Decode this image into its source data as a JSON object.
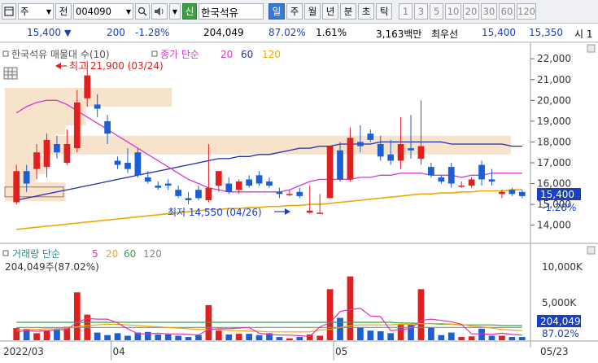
{
  "toolbar": {
    "window_icon": "window-icon",
    "type_select": "주",
    "prev_button": "전",
    "code": "004090",
    "stock_name": "한국석유",
    "credit_badge": "신",
    "periods": [
      "일",
      "주",
      "월",
      "년",
      "분",
      "초",
      "틱"
    ],
    "minutes": [
      "1",
      "3",
      "5",
      "10",
      "20",
      "30",
      "60",
      "120"
    ],
    "selected_period": "일"
  },
  "quote": {
    "price": "15,400",
    "change_arrow": "▼",
    "change": "200",
    "change_rate": "-1.28%",
    "volume": "204,049",
    "volume_ratio": "87.02%",
    "turnover_rate": "1.61%",
    "amount": "3,163백만",
    "pref_label": "최우선",
    "ask": "15,400",
    "bid": "15,350",
    "extra": "시 1"
  },
  "colors": {
    "up": "#e01f1f",
    "down": "#1a5fd6",
    "ma5": "#e52fb6",
    "ma20": "#d63bd0",
    "ma60": "#1c2fb0",
    "ma120": "#f0a800",
    "profile": "#f7e2cc"
  },
  "price_panel": {
    "title": "한국석유 매물대 수(10)",
    "ma_label": "종가 단순",
    "ma_periods": [
      "20",
      "60",
      "120"
    ],
    "high_note": "최고 21,900 (03/24)",
    "low_note": "최저 14,550 (04/26)",
    "axis_labels": [
      "22,000",
      "21,000",
      "20,000",
      "19,000",
      "18,000",
      "17,000",
      "16,000",
      "15,000",
      "14,000"
    ],
    "current_price": "15,400",
    "current_rate": "-1.28%"
  },
  "volume_panel": {
    "title": "거래량 단순",
    "ma_periods": [
      "5",
      "20",
      "60",
      "120"
    ],
    "value_label": "204,049주(87.02%)",
    "axis_labels": [
      "10,000K",
      "5,000K"
    ],
    "current_volume": "204,049",
    "current_ratio": "87.02%"
  },
  "x_axis": {
    "labels": [
      "2022/03",
      "04",
      "05",
      "05/23"
    ]
  },
  "chart_data": {
    "type": "candlestick",
    "title": "한국석유 매물대 수(10)",
    "ylim": [
      13400,
      22400
    ],
    "volume_ylim": [
      0,
      12500
    ],
    "candles": [
      {
        "o": 15100,
        "h": 16900,
        "l": 15000,
        "c": 16600,
        "v": 1900
      },
      {
        "o": 16600,
        "h": 16900,
        "l": 15600,
        "c": 16000,
        "v": 1800
      },
      {
        "o": 16700,
        "h": 17900,
        "l": 16200,
        "c": 17500,
        "v": 1100
      },
      {
        "o": 16800,
        "h": 18400,
        "l": 16300,
        "c": 18100,
        "v": 1500
      },
      {
        "o": 17900,
        "h": 18300,
        "l": 17200,
        "c": 17500,
        "v": 1700
      },
      {
        "o": 17000,
        "h": 18600,
        "l": 16900,
        "c": 17900,
        "v": 2100
      },
      {
        "o": 17700,
        "h": 20500,
        "l": 17500,
        "c": 19900,
        "v": 7500
      },
      {
        "o": 20100,
        "h": 21900,
        "l": 19700,
        "c": 21200,
        "v": 4000
      },
      {
        "o": 19800,
        "h": 20300,
        "l": 19200,
        "c": 19600,
        "v": 1200
      },
      {
        "o": 19000,
        "h": 19300,
        "l": 17900,
        "c": 18400,
        "v": 800
      },
      {
        "o": 17100,
        "h": 17300,
        "l": 16700,
        "c": 16900,
        "v": 1100
      },
      {
        "o": 17000,
        "h": 17700,
        "l": 16500,
        "c": 16700,
        "v": 700
      },
      {
        "o": 17500,
        "h": 17700,
        "l": 16300,
        "c": 16400,
        "v": 1200
      },
      {
        "o": 16300,
        "h": 16600,
        "l": 16000,
        "c": 16100,
        "v": 1300
      },
      {
        "o": 15900,
        "h": 16100,
        "l": 15700,
        "c": 15800,
        "v": 900
      },
      {
        "o": 16000,
        "h": 16200,
        "l": 15700,
        "c": 15900,
        "v": 900
      },
      {
        "o": 15700,
        "h": 15900,
        "l": 15300,
        "c": 15400,
        "v": 700
      },
      {
        "o": 15300,
        "h": 15600,
        "l": 15000,
        "c": 15200,
        "v": 500
      },
      {
        "o": 15700,
        "h": 15900,
        "l": 15200,
        "c": 15300,
        "v": 800
      },
      {
        "o": 15200,
        "h": 17900,
        "l": 15100,
        "c": 15800,
        "v": 5500
      },
      {
        "o": 15900,
        "h": 16600,
        "l": 15600,
        "c": 16600,
        "v": 1500
      },
      {
        "o": 16000,
        "h": 16300,
        "l": 15500,
        "c": 15600,
        "v": 900
      },
      {
        "o": 15700,
        "h": 16200,
        "l": 15500,
        "c": 16100,
        "v": 1000
      },
      {
        "o": 16200,
        "h": 16400,
        "l": 15800,
        "c": 15900,
        "v": 1000
      },
      {
        "o": 16400,
        "h": 16600,
        "l": 15900,
        "c": 16000,
        "v": 800
      },
      {
        "o": 16100,
        "h": 16300,
        "l": 15800,
        "c": 15900,
        "v": 1100
      },
      {
        "o": 15600,
        "h": 15800,
        "l": 15300,
        "c": 15500,
        "v": 500
      },
      {
        "o": 15500,
        "h": 15700,
        "l": 15400,
        "c": 15500,
        "v": 300
      },
      {
        "o": 15600,
        "h": 15800,
        "l": 15300,
        "c": 15400,
        "v": 500
      },
      {
        "o": 14600,
        "h": 15900,
        "l": 14550,
        "c": 14700,
        "v": 900
      },
      {
        "o": 14600,
        "h": 15500,
        "l": 14550,
        "c": 14600,
        "v": 700
      },
      {
        "o": 15300,
        "h": 17800,
        "l": 15300,
        "c": 17800,
        "v": 8000
      },
      {
        "o": 17600,
        "h": 18000,
        "l": 16100,
        "c": 16200,
        "v": 3500
      },
      {
        "o": 16200,
        "h": 18700,
        "l": 16100,
        "c": 18200,
        "v": 10000
      },
      {
        "o": 18000,
        "h": 18800,
        "l": 17500,
        "c": 17800,
        "v": 2000
      },
      {
        "o": 18400,
        "h": 18600,
        "l": 18000,
        "c": 18100,
        "v": 1500
      },
      {
        "o": 17900,
        "h": 18300,
        "l": 17100,
        "c": 17300,
        "v": 1400
      },
      {
        "o": 17400,
        "h": 18100,
        "l": 16900,
        "c": 17100,
        "v": 1100
      },
      {
        "o": 17100,
        "h": 19200,
        "l": 16700,
        "c": 17900,
        "v": 2400
      },
      {
        "o": 17700,
        "h": 19300,
        "l": 17200,
        "c": 17600,
        "v": 2400
      },
      {
        "o": 17200,
        "h": 20000,
        "l": 16900,
        "c": 17800,
        "v": 8000
      },
      {
        "o": 16800,
        "h": 17000,
        "l": 16300,
        "c": 16400,
        "v": 2000
      },
      {
        "o": 16300,
        "h": 16400,
        "l": 16000,
        "c": 16100,
        "v": 800
      },
      {
        "o": 16800,
        "h": 17000,
        "l": 15800,
        "c": 16000,
        "v": 1200
      },
      {
        "o": 15900,
        "h": 16100,
        "l": 15800,
        "c": 15900,
        "v": 500
      },
      {
        "o": 15900,
        "h": 16300,
        "l": 15800,
        "c": 16200,
        "v": 600
      },
      {
        "o": 16900,
        "h": 17100,
        "l": 15900,
        "c": 16200,
        "v": 1800
      },
      {
        "o": 16200,
        "h": 16700,
        "l": 15900,
        "c": 16100,
        "v": 700
      },
      {
        "o": 15500,
        "h": 15700,
        "l": 15300,
        "c": 15600,
        "v": 700
      },
      {
        "o": 15700,
        "h": 15800,
        "l": 15400,
        "c": 15500,
        "v": 500
      },
      {
        "o": 15600,
        "h": 15700,
        "l": 15300,
        "c": 15400,
        "v": 500
      }
    ],
    "ma20": [
      19400,
      19700,
      19900,
      20000,
      20000,
      19800,
      19500,
      19200,
      18900,
      18600,
      18300,
      18000,
      17700,
      17400,
      17100,
      16800,
      16500,
      16200,
      16000,
      15800,
      15700,
      15600,
      15600,
      15600,
      15600,
      15600,
      15600,
      15700,
      15900,
      16100,
      16200,
      16200,
      16200,
      16200,
      16300,
      16300,
      16400,
      16400,
      16500,
      16500,
      16500,
      16400,
      16400,
      16400,
      16300,
      16400,
      16400,
      16500,
      16500,
      16500,
      16500
    ],
    "ma60": [
      15200,
      15300,
      15400,
      15500,
      15600,
      15700,
      15800,
      15900,
      16000,
      16100,
      16200,
      16300,
      16400,
      16500,
      16600,
      16700,
      16800,
      16900,
      17000,
      17100,
      17200,
      17200,
      17300,
      17300,
      17400,
      17400,
      17500,
      17600,
      17700,
      17700,
      17800,
      17800,
      17900,
      17900,
      17900,
      17900,
      18000,
      18000,
      18000,
      18000,
      18000,
      18000,
      18000,
      17900,
      17900,
      17900,
      17900,
      17900,
      17900,
      17800,
      17800
    ],
    "ma120": [
      13800,
      13850,
      13900,
      13950,
      14000,
      14050,
      14100,
      14150,
      14200,
      14250,
      14300,
      14350,
      14400,
      14450,
      14500,
      14550,
      14600,
      14650,
      14700,
      14750,
      14750,
      14800,
      14800,
      14850,
      14850,
      14900,
      14900,
      14950,
      14950,
      15000,
      15000,
      15050,
      15100,
      15150,
      15200,
      15250,
      15300,
      15350,
      15400,
      15450,
      15500,
      15500,
      15550,
      15550,
      15600,
      15600,
      15650,
      15650,
      15650,
      15700,
      15700
    ],
    "vol_ma5": [
      1300,
      1500,
      1400,
      1500,
      1600,
      1700,
      2800,
      3400,
      3300,
      3300,
      2700,
      1800,
      1000,
      1000,
      1100,
      1000,
      1000,
      900,
      800,
      1700,
      1800,
      1800,
      1900,
      2000,
      1100,
      900,
      800,
      800,
      700,
      600,
      2100,
      2700,
      4500,
      4800,
      5000,
      3800,
      3700,
      1500,
      1700,
      1800,
      3100,
      3300,
      3100,
      2900,
      2500,
      1000,
      1000,
      900,
      1100,
      900,
      800
    ],
    "vol_ma20": [
      1600,
      1700,
      1700,
      1800,
      1800,
      1900,
      2100,
      2300,
      2400,
      2500,
      2500,
      2400,
      2300,
      2200,
      2100,
      2000,
      1900,
      1800,
      1700,
      1700,
      1700,
      1500,
      1500,
      1400,
      1400,
      1300,
      1300,
      1300,
      1300,
      1300,
      1600,
      1700,
      2000,
      2300,
      2400,
      2400,
      2400,
      2400,
      2500,
      2500,
      2600,
      2600,
      2600,
      2500,
      2500,
      2200,
      2100,
      1900,
      1700,
      1600,
      1500
    ],
    "vol_ma60": [
      2800,
      2800,
      2800,
      2800,
      2800,
      2800,
      2800,
      2800,
      2800,
      2800,
      2800,
      2800,
      2800,
      2800,
      2800,
      2800,
      2800,
      2800,
      2800,
      2800,
      2800,
      2800,
      2800,
      2800,
      2800,
      2800,
      2800,
      2800,
      2800,
      2800,
      2800,
      2800,
      2800,
      2800,
      2800,
      2800,
      2800,
      2800,
      2700,
      2700,
      2600,
      2600,
      2500,
      2500,
      2400,
      2400,
      2400,
      2400,
      2300,
      2300,
      2300
    ],
    "vol_ma120": [
      2000,
      2000,
      2000,
      2000,
      2000,
      2000,
      2000,
      2000,
      2000,
      2000,
      2000,
      2000,
      2000,
      2000,
      2000,
      2000,
      2000,
      2000,
      2000,
      2000,
      2000,
      2000,
      2000,
      2000,
      2000,
      2000,
      2000,
      2000,
      2000,
      2000,
      2000,
      2000,
      2000,
      2000,
      2000,
      2000,
      2000,
      2000,
      2000,
      2000,
      2000,
      2000,
      2000,
      2000,
      2000,
      2000,
      2000,
      2000,
      2000,
      2000,
      2000
    ],
    "volume_profile": [
      {
        "price": 17850,
        "size": 1.0
      },
      {
        "price": 16900,
        "size": 0.08
      },
      {
        "price": 15600,
        "size": 0.12
      },
      {
        "price": 20150,
        "size": 0.33
      },
      {
        "price": 19250,
        "size": 0.16
      },
      {
        "price": 18800,
        "size": 0.12
      },
      {
        "price": 18350,
        "size": 0.1
      },
      {
        "price": 17400,
        "size": 0.07
      },
      {
        "price": 16450,
        "size": 0.06
      },
      {
        "price": 16000,
        "size": 0.06
      }
    ],
    "profile_current_price": 15500,
    "x_labels": [
      {
        "text": "2022/03",
        "index": 0
      },
      {
        "text": "04",
        "index": 10
      },
      {
        "text": "05",
        "index": 32
      },
      {
        "text": "05/23",
        "index": 50
      }
    ]
  }
}
